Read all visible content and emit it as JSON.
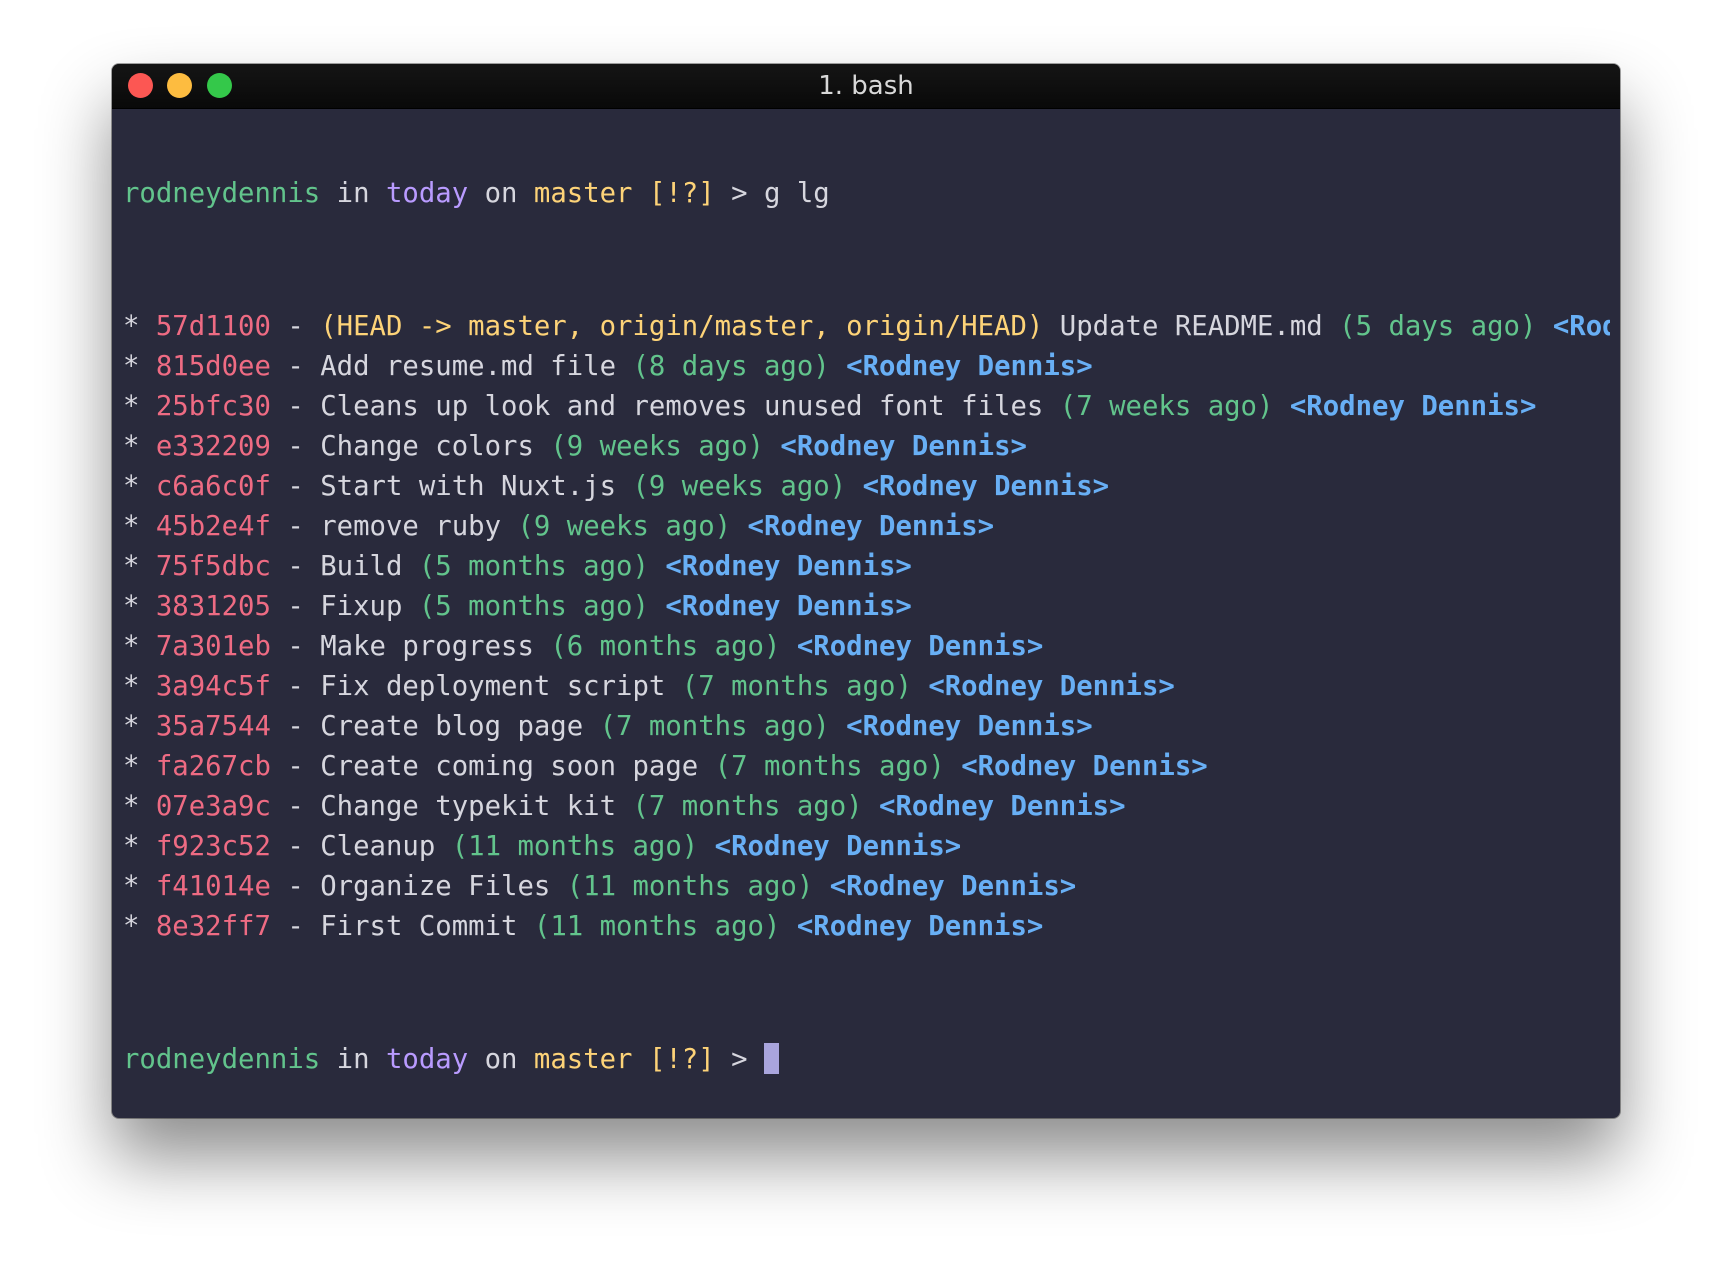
{
  "window": {
    "title": "1. bash"
  },
  "prompt": {
    "user": "rodneydennis",
    "in_word": "in",
    "directory": "today",
    "on_word": "on",
    "branch": "master",
    "status": "[!?]",
    "symbol": ">",
    "command": "g lg"
  },
  "log": [
    {
      "bullet": "*",
      "hash": "57d1100",
      "sep": "-",
      "refs": "(HEAD -> master, origin/master, origin/HEAD)",
      "message": "Update README.md",
      "date": "(5 days ago)",
      "author": "<Rod>"
    },
    {
      "bullet": "*",
      "hash": "815d0ee",
      "sep": "-",
      "refs": "",
      "message": "Add resume.md file",
      "date": "(8 days ago)",
      "author": "<Rodney Dennis>"
    },
    {
      "bullet": "*",
      "hash": "25bfc30",
      "sep": "-",
      "refs": "",
      "message": "Cleans up look and removes unused font files",
      "date": "(7 weeks ago)",
      "author": "<Rodney Dennis>"
    },
    {
      "bullet": "*",
      "hash": "e332209",
      "sep": "-",
      "refs": "",
      "message": "Change colors",
      "date": "(9 weeks ago)",
      "author": "<Rodney Dennis>"
    },
    {
      "bullet": "*",
      "hash": "c6a6c0f",
      "sep": "-",
      "refs": "",
      "message": "Start with Nuxt.js",
      "date": "(9 weeks ago)",
      "author": "<Rodney Dennis>"
    },
    {
      "bullet": "*",
      "hash": "45b2e4f",
      "sep": "-",
      "refs": "",
      "message": "remove ruby",
      "date": "(9 weeks ago)",
      "author": "<Rodney Dennis>"
    },
    {
      "bullet": "*",
      "hash": "75f5dbc",
      "sep": "-",
      "refs": "",
      "message": "Build",
      "date": "(5 months ago)",
      "author": "<Rodney Dennis>"
    },
    {
      "bullet": "*",
      "hash": "3831205",
      "sep": "-",
      "refs": "",
      "message": "Fixup",
      "date": "(5 months ago)",
      "author": "<Rodney Dennis>"
    },
    {
      "bullet": "*",
      "hash": "7a301eb",
      "sep": "-",
      "refs": "",
      "message": "Make progress",
      "date": "(6 months ago)",
      "author": "<Rodney Dennis>"
    },
    {
      "bullet": "*",
      "hash": "3a94c5f",
      "sep": "-",
      "refs": "",
      "message": "Fix deployment script",
      "date": "(7 months ago)",
      "author": "<Rodney Dennis>"
    },
    {
      "bullet": "*",
      "hash": "35a7544",
      "sep": "-",
      "refs": "",
      "message": "Create blog page",
      "date": "(7 months ago)",
      "author": "<Rodney Dennis>"
    },
    {
      "bullet": "*",
      "hash": "fa267cb",
      "sep": "-",
      "refs": "",
      "message": "Create coming soon page",
      "date": "(7 months ago)",
      "author": "<Rodney Dennis>"
    },
    {
      "bullet": "*",
      "hash": "07e3a9c",
      "sep": "-",
      "refs": "",
      "message": "Change typekit kit",
      "date": "(7 months ago)",
      "author": "<Rodney Dennis>"
    },
    {
      "bullet": "*",
      "hash": "f923c52",
      "sep": "-",
      "refs": "",
      "message": "Cleanup",
      "date": "(11 months ago)",
      "author": "<Rodney Dennis>"
    },
    {
      "bullet": "*",
      "hash": "f41014e",
      "sep": "-",
      "refs": "",
      "message": "Organize Files",
      "date": "(11 months ago)",
      "author": "<Rodney Dennis>"
    },
    {
      "bullet": "*",
      "hash": "8e32ff7",
      "sep": "-",
      "refs": "",
      "message": "First Commit",
      "date": "(11 months ago)",
      "author": "<Rodney Dennis>"
    }
  ],
  "colors": {
    "background": "#292a3c",
    "user": "#62c48c",
    "directory": "#b99bff",
    "branch": "#fdd378",
    "hash": "#ee6b83",
    "date": "#62c48c",
    "author": "#68aff5",
    "text": "#d6d6de",
    "cursor": "#a9a5dd"
  }
}
